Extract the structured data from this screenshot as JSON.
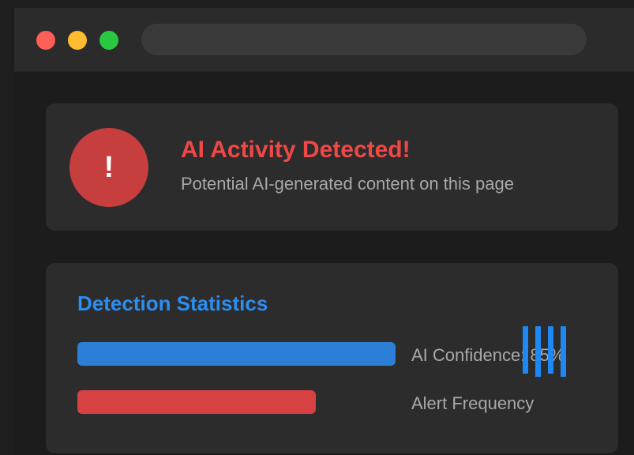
{
  "browser": {
    "window_controls": [
      "close",
      "minimize",
      "maximize"
    ],
    "address_bar_value": ""
  },
  "alert": {
    "icon_symbol": "!",
    "title": "AI Activity Detected!",
    "subtitle": "Potential AI-generated content on this page"
  },
  "stats": {
    "title": "Detection Statistics",
    "bars": [
      {
        "label": "AI Confidence: 85%",
        "level": 0.85,
        "color": "#2b7fd6"
      },
      {
        "label": "Alert Frequency",
        "color": "#d64141"
      }
    ],
    "indicator_icon": "pulse-bars-icon",
    "indicator_color": "#1e88f5"
  },
  "colors": {
    "alert_red": "#f04747",
    "accent_blue": "#2b8ef0",
    "muted_text": "#a8a8a8",
    "card_bg": "#2c2c2c"
  }
}
